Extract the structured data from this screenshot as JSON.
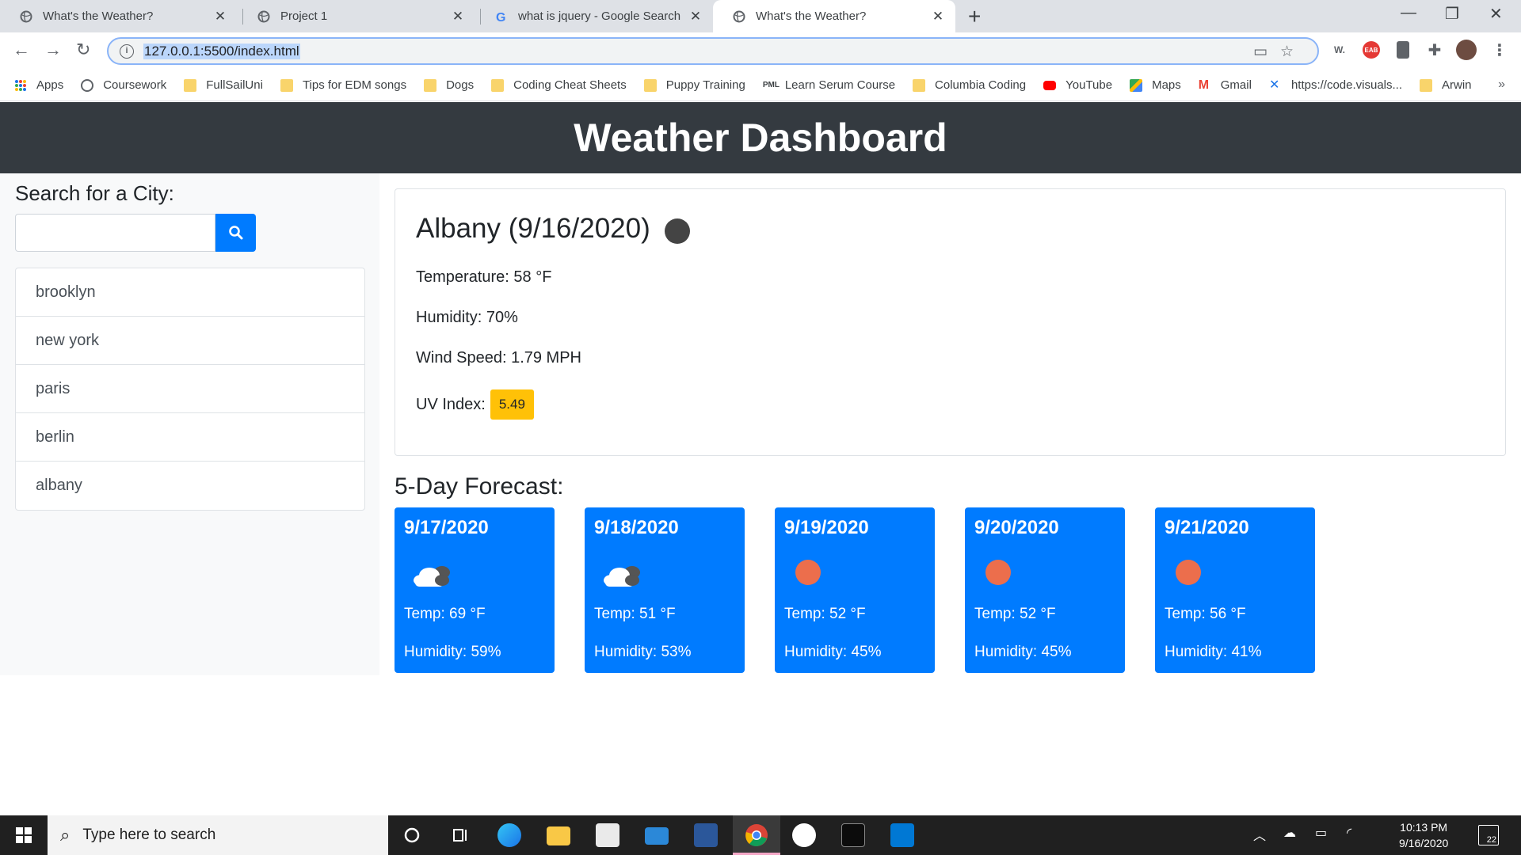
{
  "browser": {
    "tabs": [
      {
        "title": "What's the Weather?",
        "active": false
      },
      {
        "title": "Project 1",
        "active": false
      },
      {
        "title": "what is jquery - Google Search",
        "active": false
      },
      {
        "title": "What's the Weather?",
        "active": true
      }
    ],
    "url": "127.0.0.1:5500/index.html",
    "bookmarks": [
      {
        "label": "Apps",
        "icon": "apps-grid-icon"
      },
      {
        "label": "Coursework",
        "icon": "globe-icon"
      },
      {
        "label": "FullSailUni",
        "icon": "folder-icon"
      },
      {
        "label": "Tips for EDM songs",
        "icon": "folder-icon"
      },
      {
        "label": "Dogs",
        "icon": "folder-icon"
      },
      {
        "label": "Coding Cheat Sheets",
        "icon": "folder-icon"
      },
      {
        "label": "Puppy Training",
        "icon": "folder-icon"
      },
      {
        "label": "Learn Serum Course",
        "icon": "pml-icon"
      },
      {
        "label": "Columbia Coding",
        "icon": "folder-icon"
      },
      {
        "label": "YouTube",
        "icon": "youtube-icon"
      },
      {
        "label": "Maps",
        "icon": "maps-icon"
      },
      {
        "label": "Gmail",
        "icon": "gmail-icon"
      },
      {
        "label": "https://code.visuals...",
        "icon": "vscode-icon"
      },
      {
        "label": "Arwin",
        "icon": "folder-icon"
      }
    ],
    "extensions": {
      "w_label": "W.",
      "eab_label": "EAB"
    }
  },
  "page": {
    "title": "Weather Dashboard",
    "search": {
      "heading": "Search for a City:",
      "value": "",
      "placeholder": ""
    },
    "history": [
      "brooklyn",
      "new york",
      "paris",
      "berlin",
      "albany"
    ],
    "current": {
      "city_date": "Albany (9/16/2020)",
      "temperature": "Temperature: 58 °F",
      "humidity": "Humidity: 70%",
      "wind": "Wind Speed: 1.79 MPH",
      "uv_label": "UV Index:",
      "uv_value": "5.49",
      "uv_color": "#ffc107"
    },
    "forecast_title": "5-Day Forecast:",
    "forecast": [
      {
        "date": "9/17/2020",
        "icon": "cloudy-icon",
        "temp": "Temp: 69 °F",
        "humidity": "Humidity: 59%"
      },
      {
        "date": "9/18/2020",
        "icon": "cloudy-icon",
        "temp": "Temp: 51 °F",
        "humidity": "Humidity: 53%"
      },
      {
        "date": "9/19/2020",
        "icon": "sun-icon",
        "temp": "Temp: 52 °F",
        "humidity": "Humidity: 45%"
      },
      {
        "date": "9/20/2020",
        "icon": "sun-icon",
        "temp": "Temp: 52 °F",
        "humidity": "Humidity: 45%"
      },
      {
        "date": "9/21/2020",
        "icon": "sun-icon",
        "temp": "Temp: 56 °F",
        "humidity": "Humidity: 41%"
      }
    ],
    "colors": {
      "header": "#343a40",
      "accent": "#007bff",
      "sun": "#ec6e4c"
    }
  },
  "taskbar": {
    "search_placeholder": "Type here to search",
    "time": "10:13 PM",
    "date": "9/16/2020",
    "notifications": "22"
  }
}
